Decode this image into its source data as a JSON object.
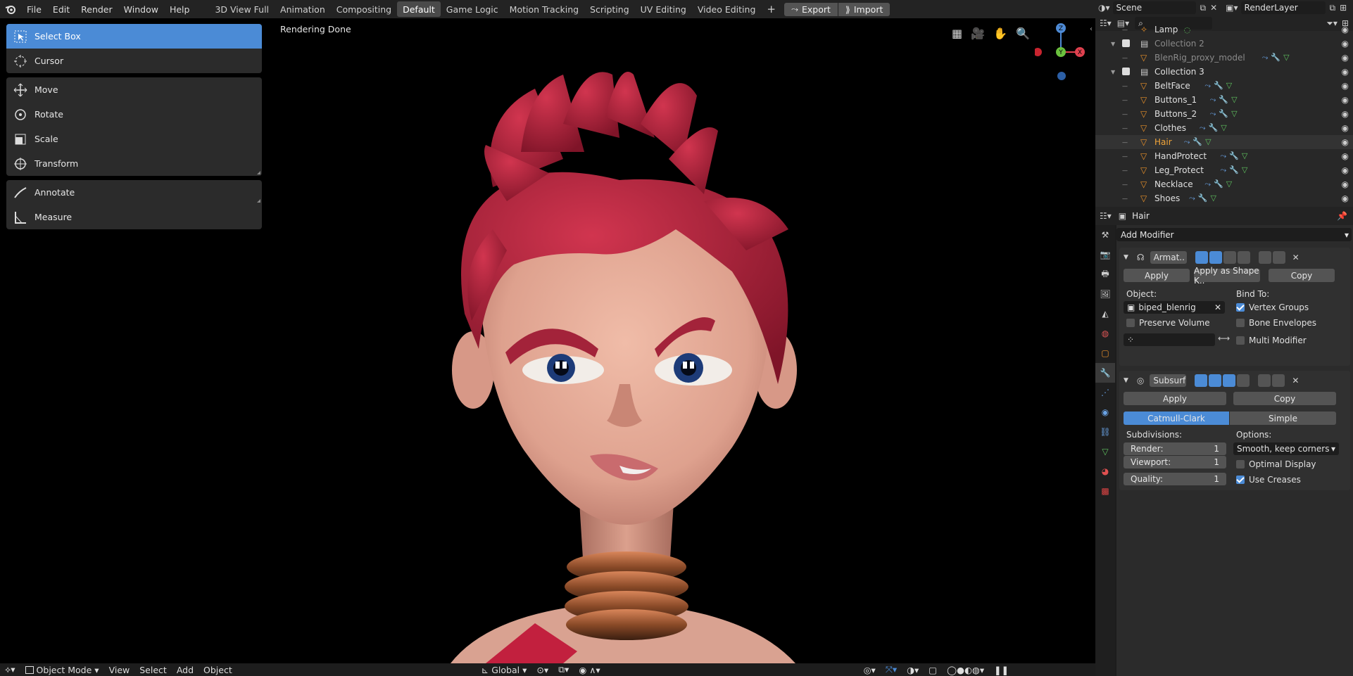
{
  "menubar": {
    "items": [
      "File",
      "Edit",
      "Render",
      "Window",
      "Help"
    ],
    "workspaces": [
      "3D View Full",
      "Animation",
      "Compositing",
      "Default",
      "Game Logic",
      "Motion Tracking",
      "Scripting",
      "UV Editing",
      "Video Editing"
    ],
    "active_workspace": "Default",
    "add_tab": "+",
    "export_label": "Export",
    "import_label": "Import",
    "scene_name": "Scene",
    "render_layer": "RenderLayer"
  },
  "toolbar": {
    "select_box": "Select Box",
    "cursor": "Cursor",
    "move": "Move",
    "rotate": "Rotate",
    "scale": "Scale",
    "transform": "Transform",
    "annotate": "Annotate",
    "measure": "Measure"
  },
  "viewport": {
    "status": "Rendering Done",
    "gizmo": {
      "z": "Z",
      "y": "Y",
      "x": "X"
    }
  },
  "bottombar": {
    "mode": "Object Mode",
    "view": "View",
    "select": "Select",
    "add": "Add",
    "object": "Object",
    "orientation": "Global"
  },
  "outliner": {
    "rows": [
      {
        "name": "Lamp",
        "dim": false
      },
      {
        "name": "Collection 2",
        "dim": true
      },
      {
        "name": "BlenRig_proxy_model",
        "dim": true
      },
      {
        "name": "Collection 3",
        "dim": false
      },
      {
        "name": "BeltFace",
        "dim": false
      },
      {
        "name": "Buttons_1",
        "dim": false
      },
      {
        "name": "Buttons_2",
        "dim": false
      },
      {
        "name": "Clothes",
        "dim": false
      },
      {
        "name": "Hair",
        "dim": false
      },
      {
        "name": "HandProtect",
        "dim": false
      },
      {
        "name": "Leg_Protect",
        "dim": false
      },
      {
        "name": "Necklace",
        "dim": false
      },
      {
        "name": "Shoes",
        "dim": false
      }
    ]
  },
  "properties": {
    "object_name": "Hair",
    "add_modifier": "Add Modifier",
    "armature": {
      "name": "Armat..",
      "apply": "Apply",
      "apply_shape": "Apply as Shape K..",
      "copy": "Copy",
      "object_label": "Object:",
      "object_value": "biped_blenrig",
      "bind_to": "Bind To:",
      "vertex_groups": "Vertex Groups",
      "bone_envelopes": "Bone Envelopes",
      "preserve_volume": "Preserve Volume",
      "multi_modifier": "Multi Modifier"
    },
    "subsurf": {
      "name": "Subsurf",
      "apply": "Apply",
      "copy": "Copy",
      "catmull": "Catmull-Clark",
      "simple": "Simple",
      "subdivisions": "Subdivisions:",
      "options": "Options:",
      "render_label": "Render:",
      "render_value": "1",
      "viewport_label": "Viewport:",
      "viewport_value": "1",
      "quality_label": "Quality:",
      "quality_value": "1",
      "uv_smooth": "Smooth, keep corners",
      "optimal_display": "Optimal Display",
      "use_creases": "Use Creases"
    }
  },
  "colors": {
    "accent": "#4b8bd6",
    "hair": "#b5213f",
    "skin": "#e3a995",
    "panel": "#2b2b2b"
  }
}
